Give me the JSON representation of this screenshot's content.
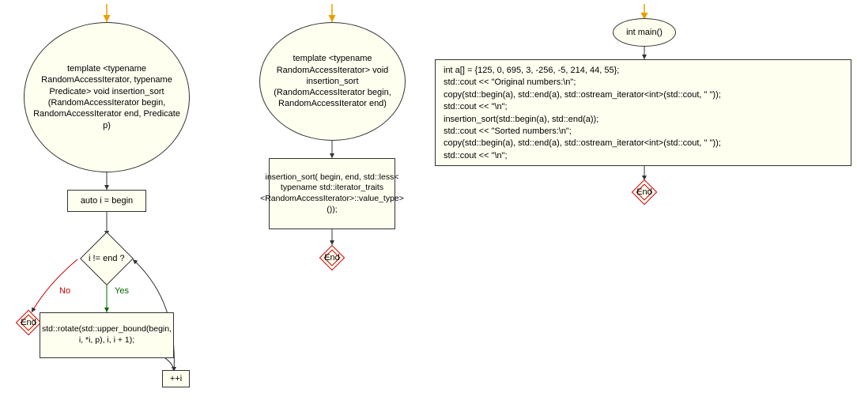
{
  "flowcharts": {
    "chart1": {
      "start_text": "template <typename RandomAccessIterator, typename Predicate> void insertion_sort (RandomAccessIterator begin, RandomAccessIterator end, Predicate p)",
      "init_box": "auto i = begin",
      "decision": "i != end ?",
      "no_label": "No",
      "yes_label": "Yes",
      "body_box": "std::rotate(std::upper_bound(begin, i, *i, p), i, i + 1);",
      "increment_box": "++i",
      "end_label": "End"
    },
    "chart2": {
      "start_text": "template <typename RandomAccessIterator> void insertion_sort (RandomAccessIterator begin, RandomAccessIterator end)",
      "body_box": "insertion_sort( begin, end, std::less< typename std::iterator_traits <RandomAccessIterator>::value_type>());",
      "end_label": "End"
    },
    "chart3": {
      "start_text": "int main()",
      "body_box": "int a[] = {125, 0, 695, 3, -256, -5, 214, 44, 55};\nstd::cout << \"Original numbers:\\n\";\ncopy(std::begin(a), std::end(a), std::ostream_iterator<int>(std::cout, \" \"));\nstd::cout << \"\\n\";\ninsertion_sort(std::begin(a), std::end(a));\nstd::cout << \"Sorted numbers:\\n\";\ncopy(std::begin(a), std::end(a), std::ostream_iterator<int>(std::cout, \" \"));\nstd::cout << \"\\n\";",
      "end_label": "End"
    }
  }
}
